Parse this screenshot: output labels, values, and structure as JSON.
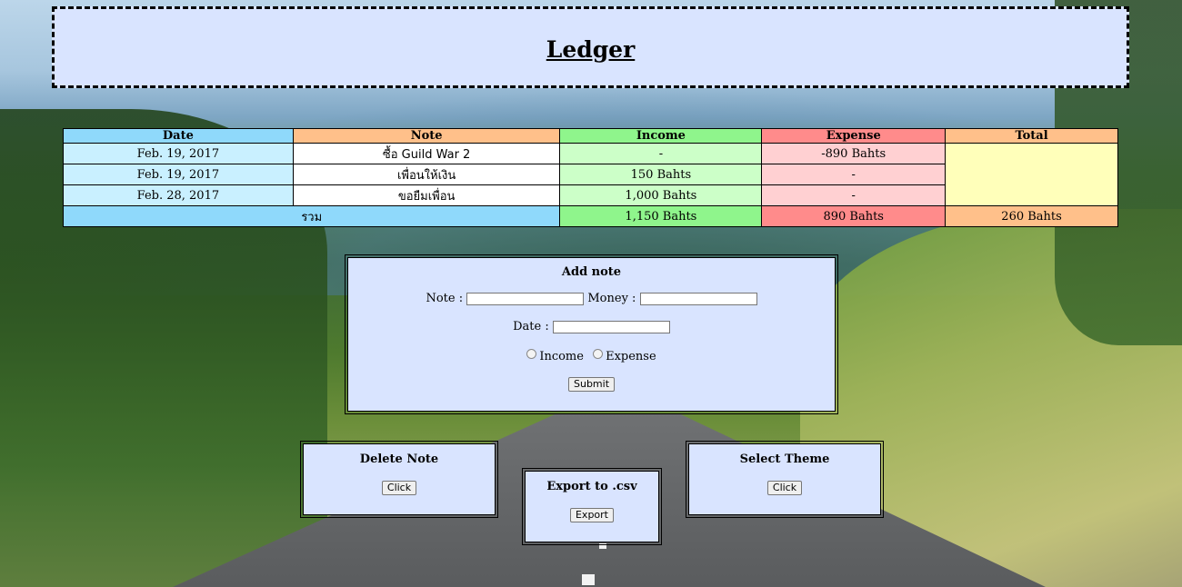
{
  "title": "Ledger",
  "table": {
    "headers": [
      "Date",
      "Note",
      "Income",
      "Expense",
      "Total"
    ],
    "rows": [
      {
        "date": "Feb. 19, 2017",
        "note": "ซื้อ Guild War 2",
        "income": "-",
        "expense": "-890 Bahts"
      },
      {
        "date": "Feb. 19, 2017",
        "note": "เพื่อนให้เงิน",
        "income": "150 Bahts",
        "expense": "-"
      },
      {
        "date": "Feb. 28, 2017",
        "note": "ขอยืมเพื่อน",
        "income": "1,000 Bahts",
        "expense": "-"
      }
    ],
    "summary": {
      "label": "รวม",
      "income": "1,150 Bahts",
      "expense": "890 Bahts",
      "total": "260 Bahts"
    }
  },
  "add_note": {
    "title": "Add note",
    "note_label": "Note :",
    "note_value": "",
    "money_label": "Money :",
    "money_value": "",
    "date_label": "Date :",
    "date_value": "",
    "income_label": "Income",
    "expense_label": "Expense",
    "submit_label": "Submit"
  },
  "delete_note": {
    "title": "Delete Note",
    "button_label": "Click"
  },
  "export_csv": {
    "title": "Export to .csv",
    "button_label": "Export"
  },
  "select_theme": {
    "title": "Select Theme",
    "button_label": "Click"
  },
  "colors": {
    "header_bg": "#d9e4ff",
    "date_col": "#8fd9fb",
    "note_col": "#ffc08a",
    "income_col": "#8ff58c",
    "expense_col": "#ff8b8b",
    "total_cell": "#ffffba"
  }
}
